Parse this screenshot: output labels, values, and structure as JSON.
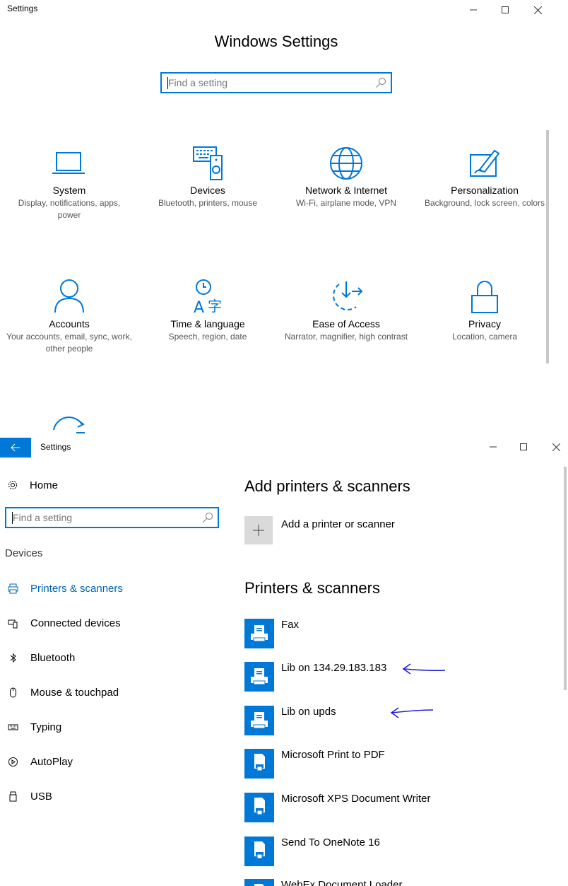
{
  "window1": {
    "title": "Settings",
    "heading": "Windows Settings",
    "search_placeholder": "Find a setting",
    "tiles": [
      {
        "name": "System",
        "desc": "Display, notifications, apps, power",
        "icon": "laptop-icon"
      },
      {
        "name": "Devices",
        "desc": "Bluetooth, printers, mouse",
        "icon": "devices-icon"
      },
      {
        "name": "Network & Internet",
        "desc": "Wi-Fi, airplane mode, VPN",
        "icon": "globe-icon"
      },
      {
        "name": "Personalization",
        "desc": "Background, lock screen, colors",
        "icon": "personalization-icon"
      },
      {
        "name": "Accounts",
        "desc": "Your accounts, email, sync, work, other people",
        "icon": "person-icon"
      },
      {
        "name": "Time & language",
        "desc": "Speech, region, date",
        "icon": "time-language-icon"
      },
      {
        "name": "Ease of Access",
        "desc": "Narrator, magnifier, high contrast",
        "icon": "ease-of-access-icon"
      },
      {
        "name": "Privacy",
        "desc": "Location, camera",
        "icon": "lock-icon"
      }
    ]
  },
  "window2": {
    "title": "Settings",
    "back_icon": "back-arrow-icon",
    "home_label": "Home",
    "search_placeholder": "Find a setting",
    "nav_group": "Devices",
    "nav_items": [
      {
        "label": "Printers & scanners",
        "icon": "printer-icon",
        "active": true
      },
      {
        "label": "Connected devices",
        "icon": "connected-devices-icon",
        "active": false
      },
      {
        "label": "Bluetooth",
        "icon": "bluetooth-icon",
        "active": false
      },
      {
        "label": "Mouse & touchpad",
        "icon": "mouse-icon",
        "active": false
      },
      {
        "label": "Typing",
        "icon": "keyboard-icon",
        "active": false
      },
      {
        "label": "AutoPlay",
        "icon": "autoplay-icon",
        "active": false
      },
      {
        "label": "USB",
        "icon": "usb-icon",
        "active": false
      }
    ],
    "add_heading": "Add printers & scanners",
    "add_label": "Add a printer or scanner",
    "list_heading": "Printers & scanners",
    "printers": [
      {
        "name": "Fax",
        "icon": "printer-icon"
      },
      {
        "name": "Lib on 134.29.183.183",
        "icon": "printer-icon"
      },
      {
        "name": "Lib on upds",
        "icon": "printer-icon"
      },
      {
        "name": "Microsoft Print to PDF",
        "icon": "document-printer-icon"
      },
      {
        "name": "Microsoft XPS Document Writer",
        "icon": "document-printer-icon"
      },
      {
        "name": "Send To OneNote 16",
        "icon": "document-printer-icon"
      },
      {
        "name": "WebEx Document Loader",
        "icon": "document-printer-icon"
      }
    ],
    "accent_color": "#0078d7"
  }
}
